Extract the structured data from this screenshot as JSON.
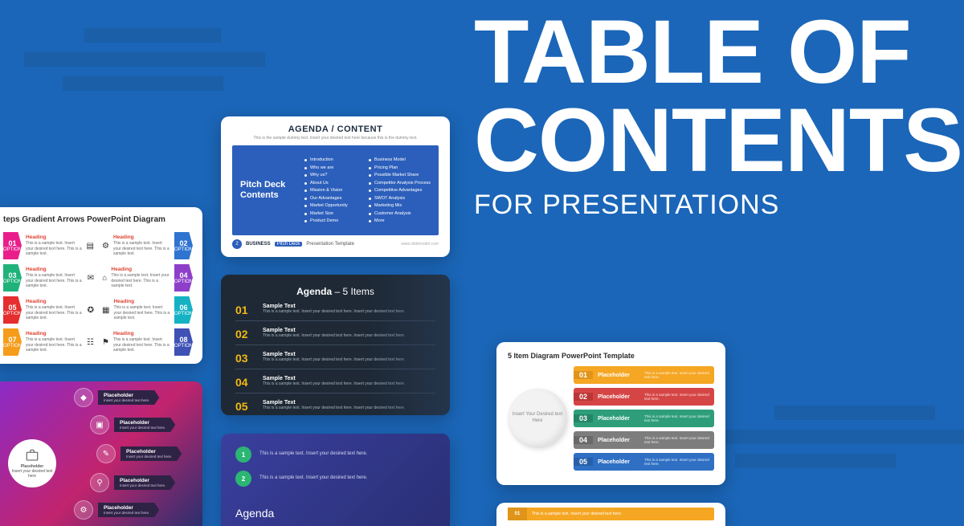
{
  "hero": {
    "line1": "TABLE OF",
    "line2": "CONTENTS",
    "sub": "FOR PRESENTATIONS"
  },
  "t1": {
    "title": "AGENDA / CONTENT",
    "caption": "This is the sample dummy text. Insert your desired text here because this is the dummy text.",
    "heading": "Pitch Deck Contents",
    "colA": [
      "Introduction",
      "Who we are",
      "Why us?",
      "About Us",
      "Mission & Vision",
      "Our Advantages",
      "Market Opportunity",
      "Market Size",
      "Product Demo"
    ],
    "colB": [
      "Business Model",
      "Pricing Plan",
      "Possible Market Share",
      "Competitor Analysis Process",
      "Competitive Advantages",
      "SWOT Analysis",
      "Marketing Mix",
      "Customer Analysis",
      "More"
    ],
    "page": "2",
    "footer_brand": "BUSINESS",
    "footer_pd": "Pitch Deck",
    "footer_tail": "Presentation Template",
    "footer_site": "www.slidemodel.com"
  },
  "t2": {
    "title": "teps Gradient Arrows PowerPoint Diagram",
    "items": [
      {
        "n": "01",
        "h": "Heading"
      },
      {
        "n": "02",
        "h": "Heading"
      },
      {
        "n": "03",
        "h": "Heading"
      },
      {
        "n": "04",
        "h": "Heading"
      },
      {
        "n": "05",
        "h": "Heading"
      },
      {
        "n": "06",
        "h": "Heading"
      },
      {
        "n": "07",
        "h": "Heading"
      },
      {
        "n": "08",
        "h": "Heading"
      }
    ],
    "body": "This is a sample text. Insert your desired text here. This is a sample text.",
    "opt": "OPTION"
  },
  "t3": {
    "title_b": "Agenda",
    "title_r": " – 5 Items",
    "rows": [
      {
        "n": "01",
        "h": "Sample Text"
      },
      {
        "n": "02",
        "h": "Sample Text"
      },
      {
        "n": "03",
        "h": "Sample Text"
      },
      {
        "n": "04",
        "h": "Sample Text"
      },
      {
        "n": "05",
        "h": "Sample Text"
      }
    ],
    "sub": "This is a sample text. Insert your desired text here. Insert your desired text here."
  },
  "t4": {
    "core_h": "Placeholder",
    "core_s": "Insert your desired text here",
    "items": [
      "Placeholder",
      "Placeholder",
      "Placeholder",
      "Placeholder",
      "Placeholder"
    ],
    "sub": "Insert your desired text here."
  },
  "t5": {
    "title": "5 Item Diagram PowerPoint Template",
    "circle": "Insert Your Desired text Here",
    "bars": [
      {
        "n": "01",
        "l": "Placeholder"
      },
      {
        "n": "02",
        "l": "Placeholder"
      },
      {
        "n": "03",
        "l": "Placeholder"
      },
      {
        "n": "04",
        "l": "Placeholder"
      },
      {
        "n": "05",
        "l": "Placeholder"
      }
    ],
    "desc": "This is a sample text. Insert your desired text here."
  },
  "t6": {
    "title": "Agenda",
    "rows": [
      {
        "n": "1",
        "t": "This is a sample text. Insert your desired text here."
      },
      {
        "n": "2",
        "t": "This is a sample text. Insert your desired text here."
      }
    ]
  },
  "t7": {
    "n": "01",
    "t": "This is a sample text. Insert your desired text here."
  }
}
